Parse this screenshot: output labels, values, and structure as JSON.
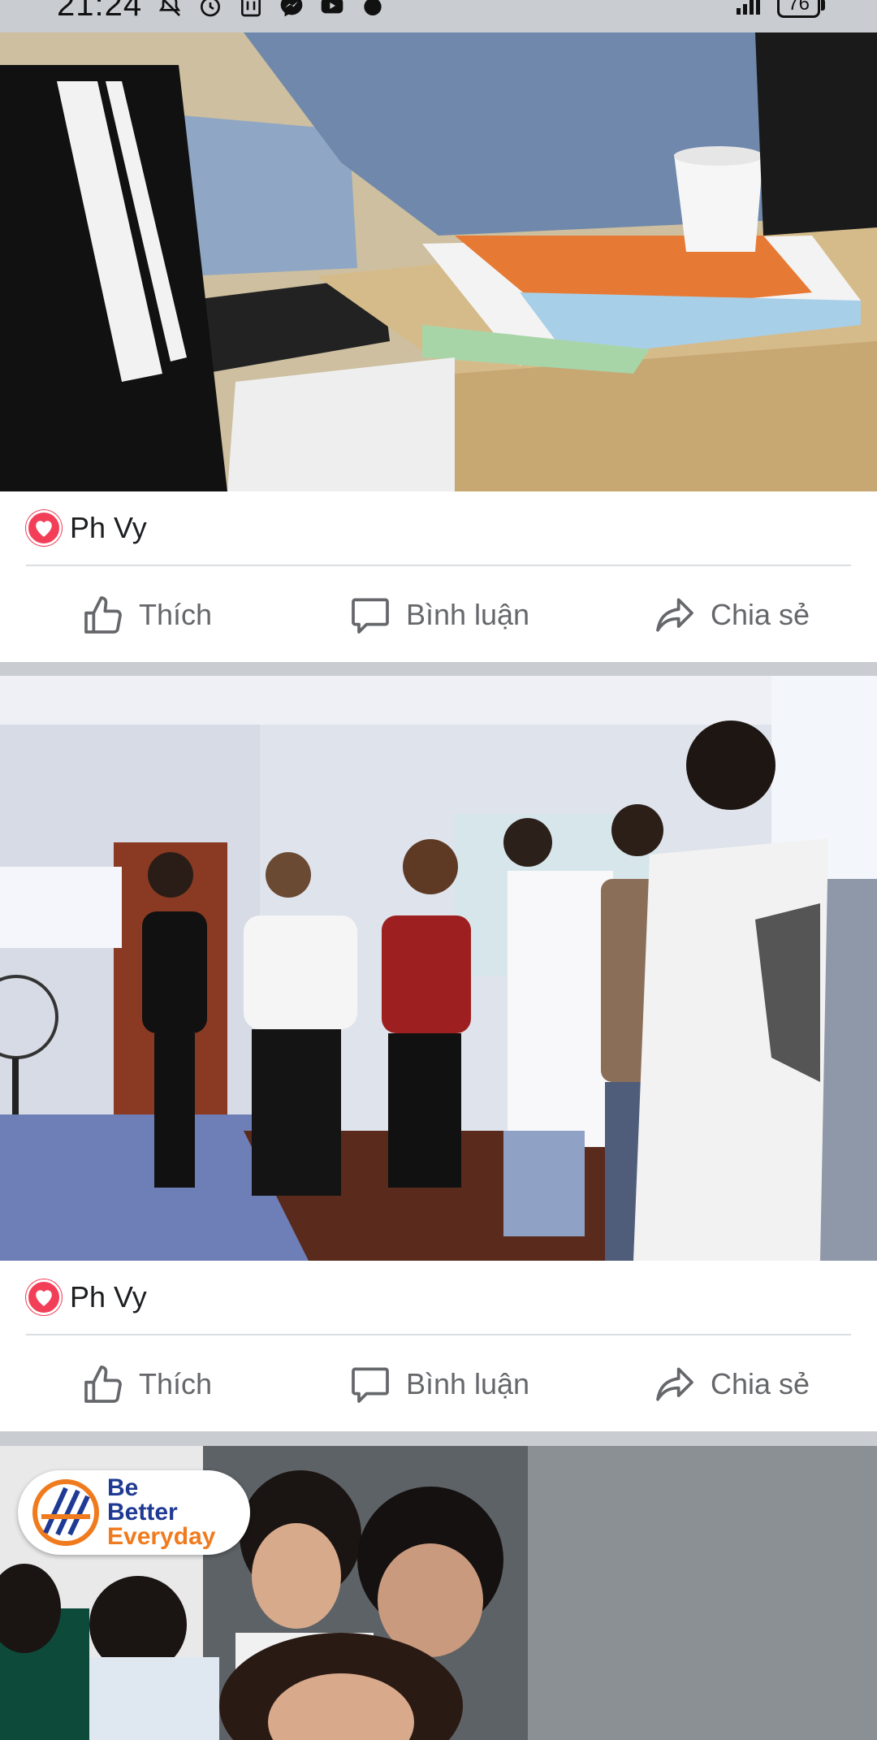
{
  "status_bar": {
    "time": "21:24",
    "battery": "76",
    "signal": "4G"
  },
  "posts": [
    {
      "reactor_name": "Ph Vy",
      "actions": {
        "like": "Thích",
        "comment": "Bình luận",
        "share": "Chia sẻ"
      }
    },
    {
      "reactor_name": "Ph Vy",
      "actions": {
        "like": "Thích",
        "comment": "Bình luận",
        "share": "Chia sẻ"
      }
    }
  ],
  "logo": {
    "line1": "Be",
    "line2": "Better",
    "line3": "Everyday"
  },
  "colors": {
    "background": "#c9ccd1",
    "card": "#ffffff",
    "reaction_heart": "#f33e58",
    "action_text": "#65676b",
    "logo_blue": "#1f3a93",
    "logo_orange": "#f07b1e"
  }
}
